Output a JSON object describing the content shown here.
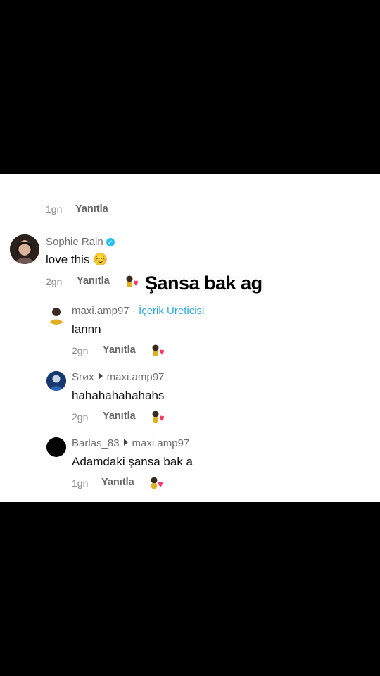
{
  "top_remnant": {
    "time": "1gn",
    "reply_label": "Yanıtla"
  },
  "comment": {
    "username": "Sophie Rain",
    "text": "love this ☺️",
    "time": "2gn",
    "reply_label": "Yanıtla",
    "sticker_text": "Şansa bak ag"
  },
  "replies": [
    {
      "username": "maxi.amp97",
      "creator_label": "· İçerik Üreticisi",
      "text": "lannn",
      "time": "2gn",
      "reply_label": "Yanıtla"
    },
    {
      "username": "Srøx",
      "reply_to": "maxi.amp97",
      "text": "hahahahahahahs",
      "time": "2gn",
      "reply_label": "Yanıtla"
    },
    {
      "username": "Barlas_83",
      "reply_to": "maxi.amp97",
      "text": "Adamdaki şansa bak a",
      "time": "1gn",
      "reply_label": "Yanıtla"
    }
  ],
  "colors": {
    "verified": "#20c3f3",
    "creator": "#2aa9e8",
    "heart": "#ff2f5f"
  },
  "icons": {
    "verified": "verified-badge-icon",
    "like": "creator-liked-heart-icon",
    "reply_arrow": "reply-arrow-icon"
  }
}
